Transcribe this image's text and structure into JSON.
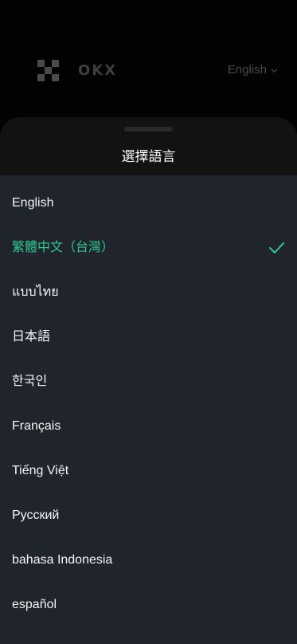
{
  "header": {
    "brand": "OKX",
    "language_switch": {
      "label": "English",
      "icon": "chevron-down-icon"
    }
  },
  "sheet": {
    "title": "選擇語言",
    "languages": [
      {
        "label": "English",
        "selected": false
      },
      {
        "label": "繁體中文（台灣）",
        "selected": true
      },
      {
        "label": "แบบไทย",
        "selected": false
      },
      {
        "label": "日本語",
        "selected": false
      },
      {
        "label": "한국인",
        "selected": false
      },
      {
        "label": "Français",
        "selected": false
      },
      {
        "label": "Tiếng Việt",
        "selected": false
      },
      {
        "label": "Русский",
        "selected": false
      },
      {
        "label": "bahasa Indonesia",
        "selected": false
      },
      {
        "label": "español",
        "selected": false
      }
    ],
    "selected_icon": "checkmark-icon"
  },
  "colors": {
    "background": "#000000",
    "sheet_background": "#1f242d",
    "sheet_header_background": "#121212",
    "text": "#f5f5f5",
    "accent": "#2fc88f",
    "dim_text": "#4a4a4a"
  }
}
